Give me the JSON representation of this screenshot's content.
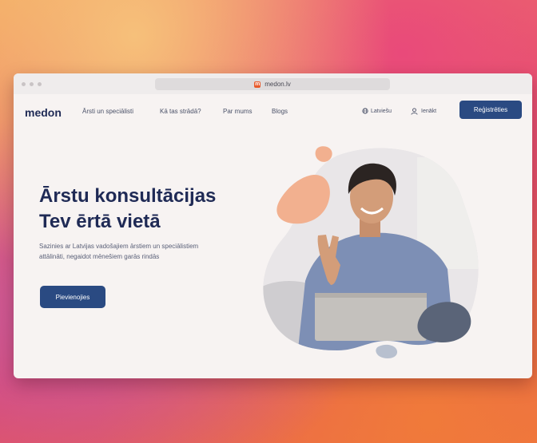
{
  "browser": {
    "url": "medon.lv",
    "favicon_letter": "m"
  },
  "nav": {
    "logo": "medon",
    "links": [
      "Ārsti un speciālisti",
      "Kā tas strādā?",
      "Par mums",
      "Blogs"
    ],
    "language": "Latviešu",
    "login": "Ienākt",
    "register": "Reģistrēties"
  },
  "hero": {
    "title_line1": "Ārstu konsultācijas",
    "title_line2": "Tev ērtā vietā",
    "description": "Sazinies ar Latvijas vadošajiem ārstiem un speciālistiem attālināti, negaidot mēnešiem garās rindās",
    "cta": "Pievienojies"
  },
  "colors": {
    "brand_navy": "#1f2a55",
    "button_blue": "#2a4a82",
    "blob_peach": "#f2b08f",
    "blob_slate": "#5a6478"
  },
  "icons": {
    "globe": "globe-icon",
    "user": "user-icon"
  }
}
